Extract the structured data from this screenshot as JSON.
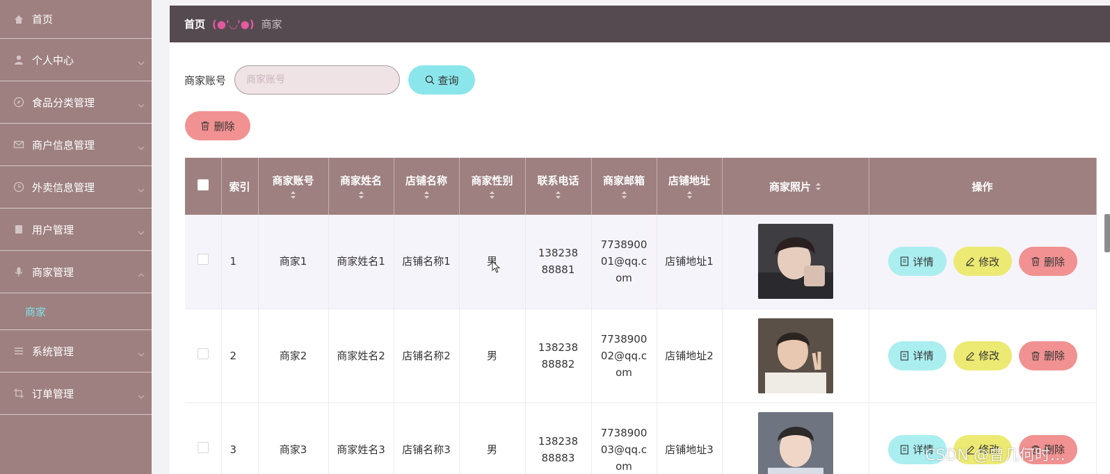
{
  "sidebar": {
    "items": [
      {
        "label": "首页",
        "icon": "home-icon"
      },
      {
        "label": "个人中心",
        "icon": "user-icon"
      },
      {
        "label": "食品分类管理",
        "icon": "compass-icon"
      },
      {
        "label": "商户信息管理",
        "icon": "mail-icon"
      },
      {
        "label": "外卖信息管理",
        "icon": "clock-icon"
      },
      {
        "label": "用户管理",
        "icon": "book-icon"
      },
      {
        "label": "商家管理",
        "icon": "mic-icon"
      },
      {
        "label": "系统管理",
        "icon": "list-icon"
      },
      {
        "label": "订单管理",
        "icon": "crop-icon"
      }
    ],
    "submenu": {
      "label": "商家"
    }
  },
  "breadcrumb": {
    "home": "首页",
    "separator": "(●'◡'●)",
    "current": "商家"
  },
  "search": {
    "label": "商家账号",
    "placeholder": "商家账号",
    "button": "查询"
  },
  "toolbar": {
    "delete_label": "删除"
  },
  "table": {
    "headers": [
      "索引",
      "商家账号",
      "商家姓名",
      "店铺名称",
      "商家性别",
      "联系电话",
      "商家邮箱",
      "店铺地址",
      "商家照片",
      "操作"
    ],
    "rows": [
      {
        "index": "1",
        "account": "商家1",
        "name": "商家姓名1",
        "shop": "店铺名称1",
        "gender": "男",
        "phone": "13823888881",
        "email": "773890001@qq.com",
        "address": "店铺地址1"
      },
      {
        "index": "2",
        "account": "商家2",
        "name": "商家姓名2",
        "shop": "店铺名称2",
        "gender": "男",
        "phone": "13823888882",
        "email": "773890002@qq.com",
        "address": "店铺地址2"
      },
      {
        "index": "3",
        "account": "商家3",
        "name": "商家姓名3",
        "shop": "店铺名称3",
        "gender": "男",
        "phone": "13823888883",
        "email": "773890003@qq.com",
        "address": "店铺地址3"
      }
    ],
    "actions": {
      "detail": "详情",
      "edit": "修改",
      "delete": "删除"
    }
  },
  "watermark": "CSDN @曾几何时…",
  "colors": {
    "sidebar": "#9e8080",
    "header": "#554a50",
    "accent": "#7fe3e8",
    "query": "#8be6ec",
    "danger": "#f19191",
    "edit": "#ecea72",
    "detail": "#aaeef0"
  }
}
